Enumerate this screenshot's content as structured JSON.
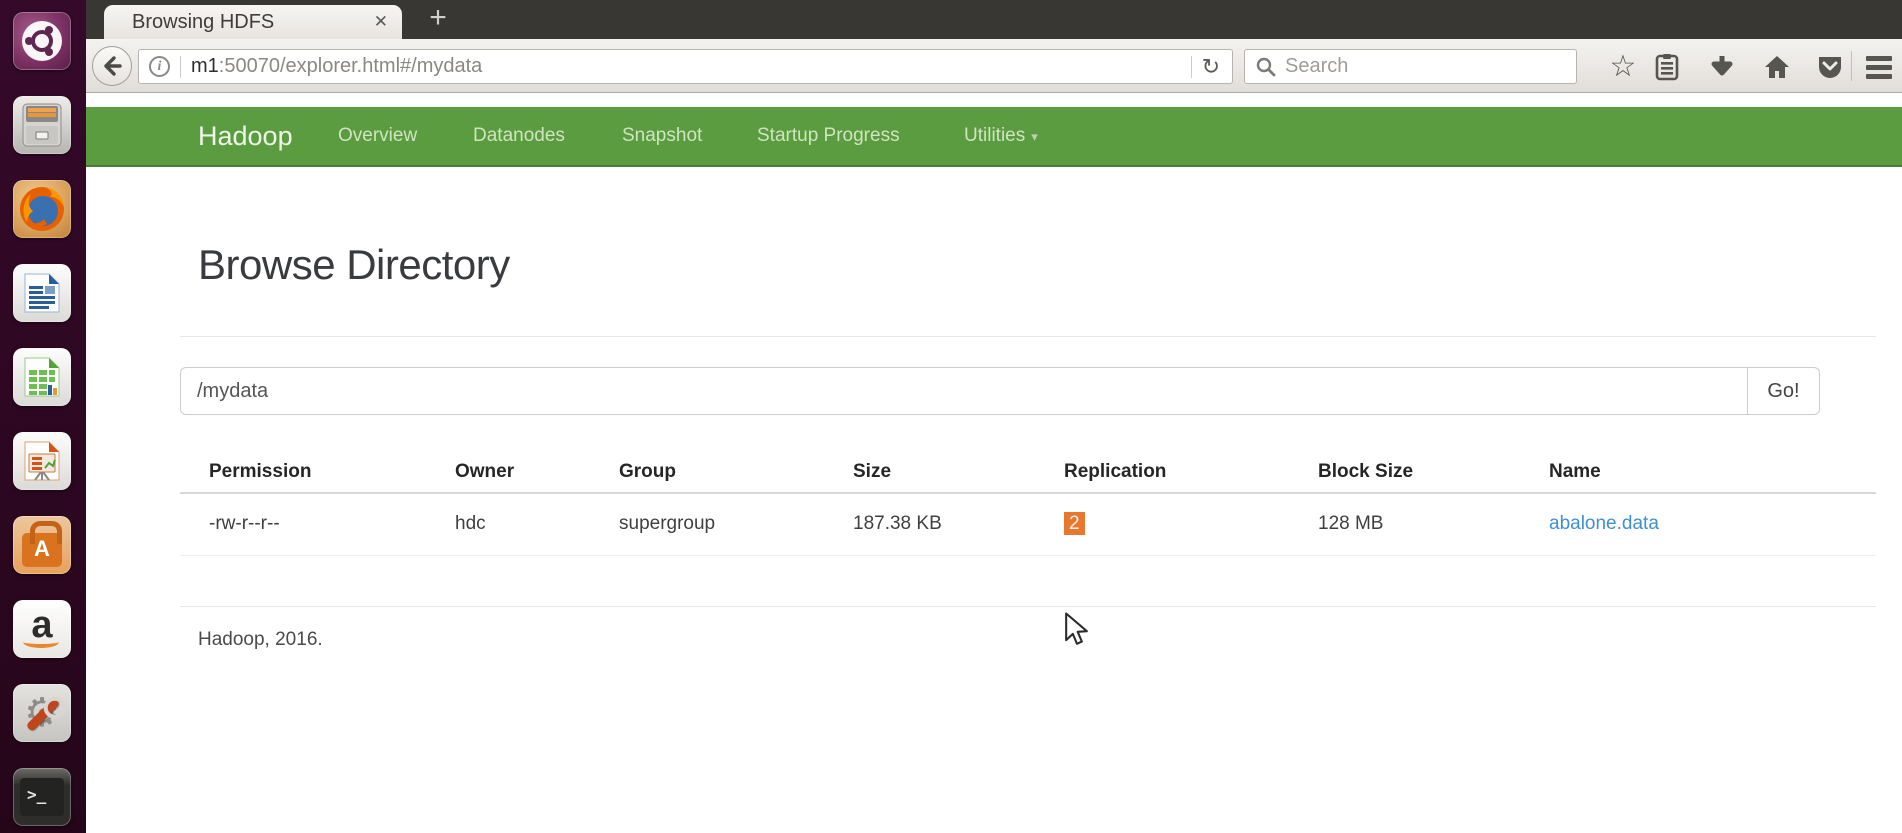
{
  "launcher": {
    "items": [
      {
        "name": "dash-home"
      },
      {
        "name": "file-manager"
      },
      {
        "name": "firefox",
        "active": true
      },
      {
        "name": "libreoffice-writer"
      },
      {
        "name": "libreoffice-calc"
      },
      {
        "name": "libreoffice-impress"
      },
      {
        "name": "software-center"
      },
      {
        "name": "amazon"
      },
      {
        "name": "system-settings"
      },
      {
        "name": "terminal",
        "active": true
      }
    ]
  },
  "browser": {
    "tab_title": "Browsing HDFS",
    "url_domain": "m1",
    "url_rest": ":50070/explorer.html#/mydata",
    "search_placeholder": "Search"
  },
  "icons": {
    "close_tab": "✕",
    "new_tab": "+",
    "info": "i",
    "reload": "↻",
    "star": "☆",
    "gear": "⚙",
    "caret_down": "▾",
    "terminal_prompt": ">_",
    "amazon_a": "a",
    "software_a": "A"
  },
  "navbar": {
    "brand": "Hadoop",
    "links": [
      "Overview",
      "Datanodes",
      "Snapshot",
      "Startup Progress",
      "Utilities"
    ]
  },
  "page": {
    "title": "Browse Directory",
    "path_input_value": "/mydata",
    "go_button": "Go!",
    "table": {
      "headers": [
        "Permission",
        "Owner",
        "Group",
        "Size",
        "Replication",
        "Block Size",
        "Name"
      ],
      "row": {
        "permission": "-rw-r--r--",
        "owner": "hdc",
        "group": "supergroup",
        "size": "187.38 KB",
        "replication": "2",
        "block_size": "128 MB",
        "name": "abalone.data"
      }
    },
    "footer": "Hadoop, 2016."
  },
  "colors": {
    "navbar_green": "#5b9c40",
    "link_blue": "#3f8fd1",
    "replication_highlight": "#e8772f",
    "launcher_purple": "#2c0721"
  }
}
